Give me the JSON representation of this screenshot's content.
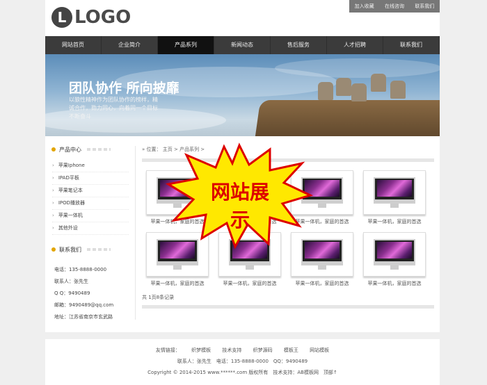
{
  "logo": {
    "letter": "L",
    "text": "LOGO"
  },
  "toplinks": [
    "加入收藏",
    "在线咨询",
    "联系我们"
  ],
  "nav": [
    {
      "label": "网站首页",
      "active": false
    },
    {
      "label": "企业简介",
      "active": false
    },
    {
      "label": "产品系列",
      "active": true
    },
    {
      "label": "新闻动态",
      "active": false
    },
    {
      "label": "售后服务",
      "active": false
    },
    {
      "label": "人才招聘",
      "active": false
    },
    {
      "label": "联系我们",
      "active": false
    }
  ],
  "banner": {
    "title": "团队协作 所向披靡",
    "subtitle": "以狼性精神作为团队协作的榜样，精诚合作，勠力同心，向着同一个目标不断奋斗"
  },
  "sidebar": {
    "products_title": "产品中心",
    "products": [
      "苹果Iphone",
      "IPAD平板",
      "苹果笔记本",
      "IPOD播放器",
      "苹果一体机",
      "其他外设"
    ],
    "contact_title": "联系我们",
    "contact": [
      "电话：135-8888-0000",
      "联系人：张先生",
      "Q Q：9490489",
      "邮箱：9490489@qq.com",
      "地址：江苏省南京市玄武路"
    ]
  },
  "breadcrumb": "位置： 主页 > 产品系列 >",
  "products": [
    "苹果一体机，家庭的首选",
    "苹果一体机，家庭的首选",
    "苹果一体机，家庭的首选",
    "苹果一体机，家庭的首选",
    "苹果一体机，家庭的首选",
    "苹果一体机，家庭的首选",
    "苹果一体机，家庭的首选",
    "苹果一体机，家庭的首选"
  ],
  "pager": "共 1页8条记录",
  "overlay": "网站展示",
  "footer": {
    "links_label": "友情链接：",
    "links": [
      "织梦模板",
      "技术支持",
      "织梦源码",
      "模板王",
      "网站模板"
    ],
    "contact_line": "联系人：张先生　电话：135-8888-0000　QQ：9490489",
    "copyright": "Copyright © 2014-2015 www.******.com 版权所有　技术支持：AB模板网　顶部↑"
  },
  "colors": {
    "nav_bg": "#3b3b3b",
    "nav_active": "#111111",
    "accent_dot": "#e2a500",
    "burst_fill": "#ffe800",
    "burst_text": "#dd0000"
  }
}
